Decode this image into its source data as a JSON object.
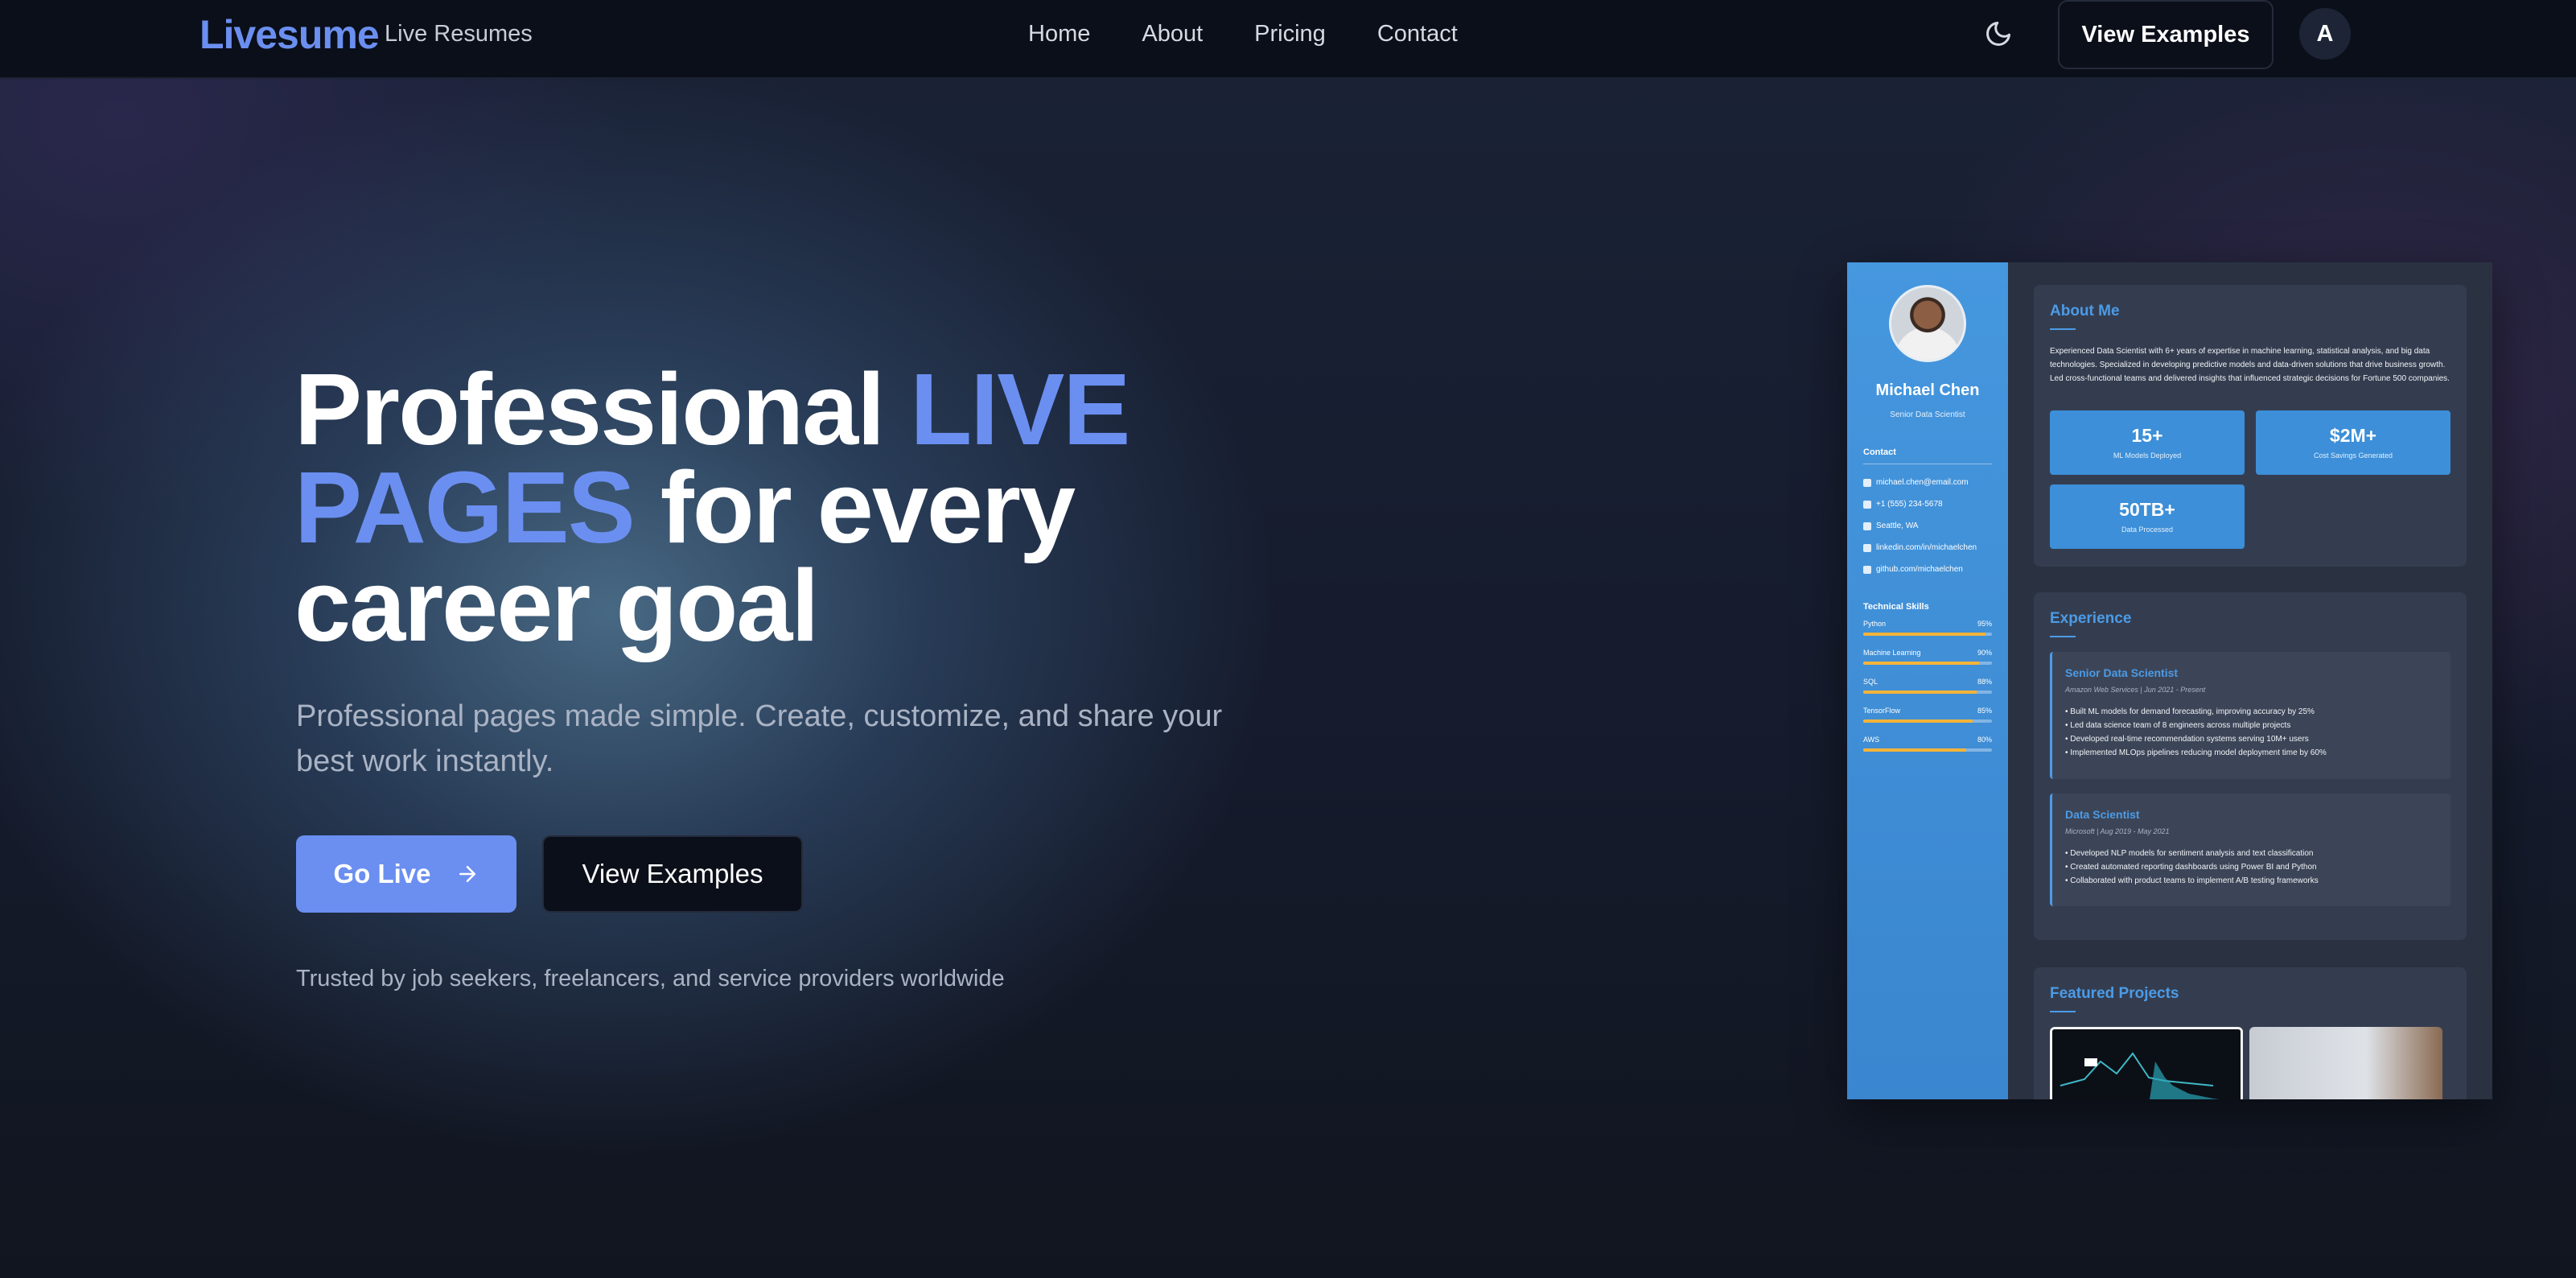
{
  "nav": {
    "brand": "Livesume",
    "brand_sub": "Live Resumes",
    "links": [
      "Home",
      "About",
      "Pricing",
      "Contact"
    ],
    "theme_icon": "moon-icon",
    "cta": "View Examples",
    "avatar_initial": "A"
  },
  "hero": {
    "title_part1": "Professional ",
    "title_accent1": "LIVE",
    "title_accent2": "PAGES",
    "title_part2": " for every",
    "title_part3": "career goal",
    "description": "Professional pages made simple. Create, customize, and share your best work instantly.",
    "primary_button": "Go Live",
    "secondary_button": "View Examples",
    "trusted": "Trusted by job seekers, freelancers, and service providers worldwide"
  },
  "colors": {
    "accent": "#6b8ff0",
    "sidebar_blue": "#4597de",
    "skill_bar": "#f4b43a"
  },
  "preview": {
    "name": "Michael Chen",
    "role": "Senior Data Scientist",
    "contact_heading": "Contact",
    "contacts": [
      {
        "icon": "email-icon",
        "text": "michael.chen@email.com"
      },
      {
        "icon": "phone-icon",
        "text": "+1 (555) 234-5678"
      },
      {
        "icon": "location-icon",
        "text": "Seattle, WA"
      },
      {
        "icon": "linkedin-icon",
        "text": "linkedin.com/in/michaelchen"
      },
      {
        "icon": "github-icon",
        "text": "github.com/michaelchen"
      }
    ],
    "skills_heading": "Technical Skills",
    "skills": [
      {
        "name": "Python",
        "pct": "95%",
        "value": 95
      },
      {
        "name": "Machine Learning",
        "pct": "90%",
        "value": 90
      },
      {
        "name": "SQL",
        "pct": "88%",
        "value": 88
      },
      {
        "name": "TensorFlow",
        "pct": "85%",
        "value": 85
      },
      {
        "name": "AWS",
        "pct": "80%",
        "value": 80
      }
    ],
    "about_title": "About Me",
    "about_text": "Experienced Data Scientist with 6+ years of expertise in machine learning, statistical analysis, and big data technologies. Specialized in developing predictive models and data-driven solutions that drive business growth. Led cross-functional teams and delivered insights that influenced strategic decisions for Fortune 500 companies.",
    "stats": [
      {
        "num": "15+",
        "label": "ML Models Deployed"
      },
      {
        "num": "$2M+",
        "label": "Cost Savings Generated"
      },
      {
        "num": "50TB+",
        "label": "Data Processed"
      }
    ],
    "experience_title": "Experience",
    "jobs": [
      {
        "title": "Senior Data Scientist",
        "company": "Amazon Web Services | Jun 2021 - Present",
        "bullets": [
          "Built ML models for demand forecasting, improving accuracy by 25%",
          "Led data science team of 8 engineers across multiple projects",
          "Developed real-time recommendation systems serving 10M+ users",
          "Implemented MLOps pipelines reducing model deployment time by 60%"
        ]
      },
      {
        "title": "Data Scientist",
        "company": "Microsoft | Aug 2019 - May 2021",
        "bullets": [
          "Developed NLP models for sentiment analysis and text classification",
          "Created automated reporting dashboards using Power BI and Python",
          "Collaborated with product teams to implement A/B testing frameworks"
        ]
      }
    ],
    "projects_title": "Featured Projects"
  }
}
